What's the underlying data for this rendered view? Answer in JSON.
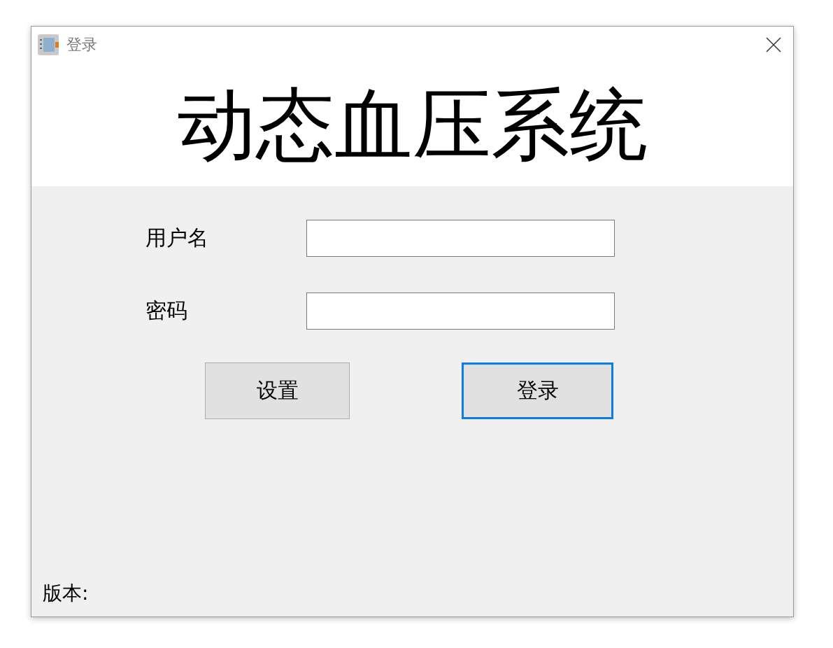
{
  "window": {
    "title": "登录"
  },
  "header": {
    "title": "动态血压系统"
  },
  "form": {
    "fields": [
      {
        "label": "用户名"
      },
      {
        "label": "密码"
      }
    ]
  },
  "buttons": [
    {
      "label": "设置",
      "focused": false
    },
    {
      "label": "登录",
      "focused": true
    }
  ],
  "status": {
    "version_label": "版本:"
  }
}
